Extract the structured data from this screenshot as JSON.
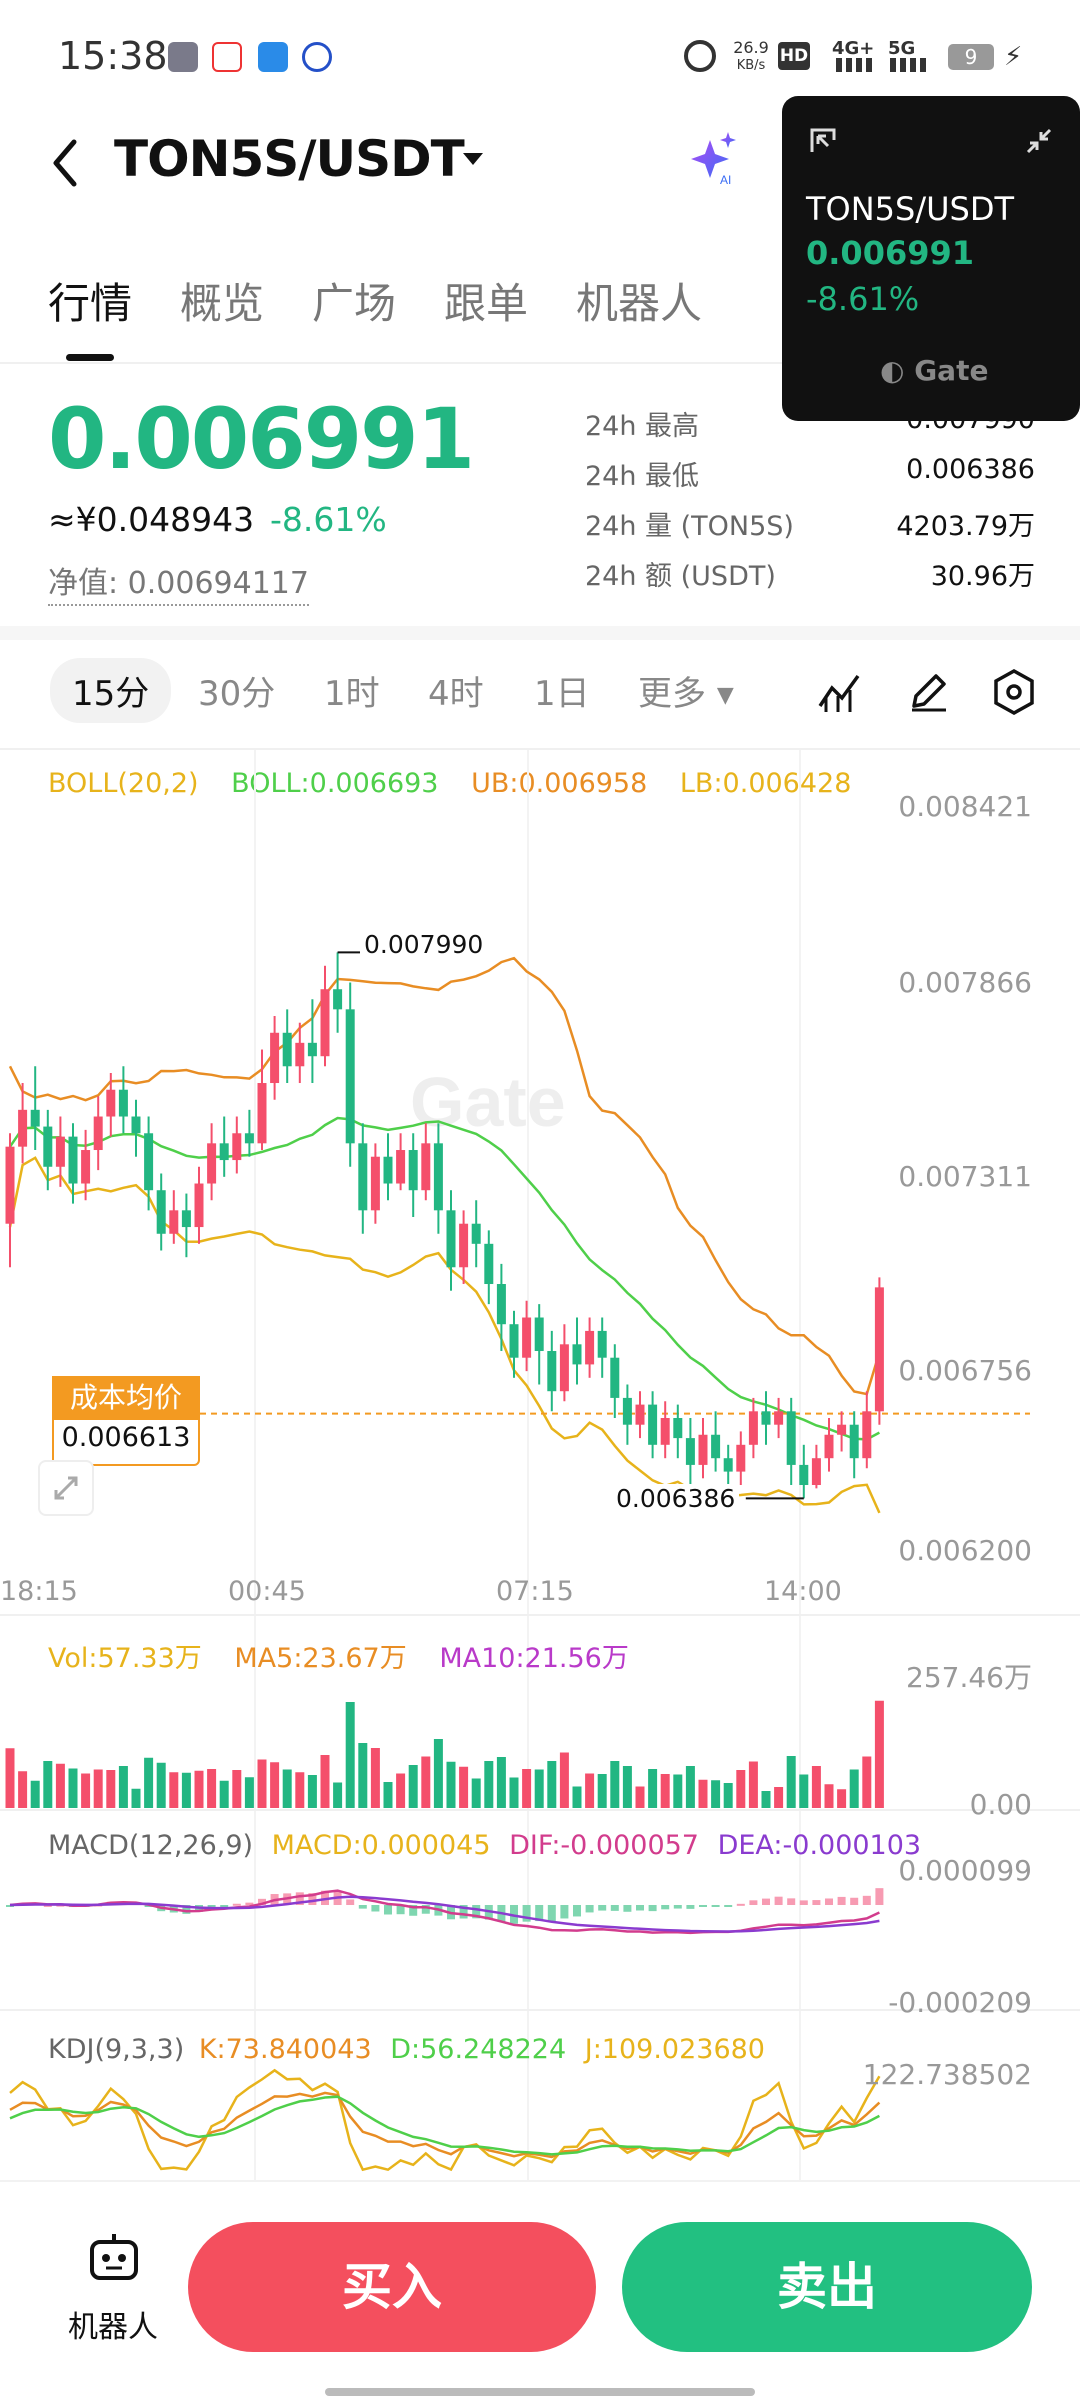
{
  "statusbar": {
    "time": "15:38",
    "net_speed_value": "26.9",
    "net_speed_unit": "KB/s",
    "hd": "HD",
    "sim1": "4G+",
    "sim2": "5G",
    "battery": "9",
    "app_icons": [
      "voice-recorder-icon",
      "weibo-icon",
      "app-icon",
      "blue-app-icon"
    ]
  },
  "header": {
    "pair": "TON5S/USDT",
    "ai_label": "AI"
  },
  "tabs": [
    "行情",
    "概览",
    "广场",
    "跟单",
    "机器人"
  ],
  "summary": {
    "last_price": "0.006991",
    "cny_price": "≈¥0.048943",
    "change_pct": "-8.61%",
    "nav": "净值: 0.00694117"
  },
  "stats": [
    {
      "label": "24h  最高",
      "value": "0.007990"
    },
    {
      "label": "24h  最低",
      "value": "0.006386"
    },
    {
      "label": "24h  量 (TON5S)",
      "value": "4203.79万"
    },
    {
      "label": "24h  额 (USDT)",
      "value": "30.96万"
    }
  ],
  "intervals": [
    "15分",
    "30分",
    "1时",
    "4时",
    "1日",
    "更多"
  ],
  "main_chart_legend": {
    "boll": "BOLL(20,2)",
    "boll_val": "BOLL:0.006693",
    "ub": "UB:0.006958",
    "lb": "LB:0.006428"
  },
  "cost_avg": {
    "label": "成本均价",
    "value": "0.006613"
  },
  "high_marker": "0.007990",
  "low_marker": "0.006386",
  "volume_legend": {
    "vol": "Vol:57.33万",
    "ma5": "MA5:23.67万",
    "ma10": "MA10:21.56万"
  },
  "macd_legend": {
    "title": "MACD(12,26,9)",
    "macd": "MACD:0.000045",
    "dif": "DIF:-0.000057",
    "dea": "DEA:-0.000103"
  },
  "kdj_legend": {
    "title": "KDJ(9,3,3)",
    "k": "K:73.840043",
    "d": "D:56.248224",
    "j": "J:109.023680"
  },
  "mini_card": {
    "pair": "TON5S/USDT",
    "price": "0.006991",
    "change": "-8.61%",
    "brand": "Gate"
  },
  "bottom": {
    "robot": "机器人",
    "buy": "买入",
    "sell": "卖出"
  },
  "colors": {
    "up": "#f44f6b",
    "down": "#22b682",
    "boll": "#4fcf4a",
    "ub": "#e88d24",
    "lb": "#e7b31b",
    "accent": "#f39a21"
  },
  "chart_data": {
    "type": "candlestick",
    "price_axis": [
      "0.008421",
      "0.007866",
      "0.007311",
      "0.006756",
      "0.006200"
    ],
    "volume_axis": [
      "257.46万",
      "0.00"
    ],
    "macd_axis": [
      "0.000099",
      "-0.000209"
    ],
    "kdj_axis": [
      "122.738502"
    ],
    "time_axis": [
      "18:15",
      "00:45",
      "07:15",
      "14:00"
    ],
    "ylim": [
      0.0062,
      0.008421
    ],
    "candles": [
      [
        0.00718,
        0.00741,
        0.00705,
        0.00745
      ],
      [
        0.00741,
        0.00752,
        0.00736,
        0.0076
      ],
      [
        0.00752,
        0.00747,
        0.0074,
        0.00765
      ],
      [
        0.00747,
        0.00735,
        0.00728,
        0.00752
      ],
      [
        0.00735,
        0.00744,
        0.00729,
        0.0075
      ],
      [
        0.00744,
        0.0073,
        0.00724,
        0.00748
      ],
      [
        0.0073,
        0.0074,
        0.00725,
        0.00746
      ],
      [
        0.0074,
        0.0075,
        0.00734,
        0.00756
      ],
      [
        0.0075,
        0.00758,
        0.00744,
        0.00763
      ],
      [
        0.00758,
        0.0075,
        0.00745,
        0.00765
      ],
      [
        0.0075,
        0.00745,
        0.00738,
        0.00755
      ],
      [
        0.00745,
        0.00728,
        0.00722,
        0.0075
      ],
      [
        0.00728,
        0.00715,
        0.0071,
        0.00733
      ],
      [
        0.00715,
        0.00722,
        0.00712,
        0.00728
      ],
      [
        0.00722,
        0.00717,
        0.00708,
        0.00727
      ],
      [
        0.00717,
        0.0073,
        0.00712,
        0.00735
      ],
      [
        0.0073,
        0.00742,
        0.00725,
        0.00748
      ],
      [
        0.00742,
        0.00737,
        0.00732,
        0.0075
      ],
      [
        0.00737,
        0.00745,
        0.00733,
        0.0075
      ],
      [
        0.00745,
        0.00742,
        0.00738,
        0.00752
      ],
      [
        0.00742,
        0.0076,
        0.0074,
        0.0077
      ],
      [
        0.0076,
        0.00775,
        0.00755,
        0.0078
      ],
      [
        0.00775,
        0.00765,
        0.0076,
        0.00782
      ],
      [
        0.00765,
        0.00772,
        0.0076,
        0.00778
      ],
      [
        0.00772,
        0.00768,
        0.0076,
        0.00785
      ],
      [
        0.00768,
        0.00788,
        0.00765,
        0.00795
      ],
      [
        0.00788,
        0.00782,
        0.00775,
        0.00799
      ],
      [
        0.00782,
        0.00742,
        0.00735,
        0.0079
      ],
      [
        0.00742,
        0.00722,
        0.00715,
        0.00748
      ],
      [
        0.00722,
        0.00738,
        0.00718,
        0.00742
      ],
      [
        0.00738,
        0.0073,
        0.00725,
        0.00745
      ],
      [
        0.0073,
        0.0074,
        0.00728,
        0.00745
      ],
      [
        0.0074,
        0.00728,
        0.0072,
        0.00745
      ],
      [
        0.00728,
        0.00742,
        0.00725,
        0.00748
      ],
      [
        0.00742,
        0.00722,
        0.00715,
        0.00748
      ],
      [
        0.00722,
        0.00705,
        0.00698,
        0.00728
      ],
      [
        0.00705,
        0.00718,
        0.007,
        0.00722
      ],
      [
        0.00718,
        0.00712,
        0.00705,
        0.00725
      ],
      [
        0.00712,
        0.007,
        0.00694,
        0.00716
      ],
      [
        0.007,
        0.00688,
        0.0068,
        0.00706
      ],
      [
        0.00688,
        0.00678,
        0.00672,
        0.00692
      ],
      [
        0.00678,
        0.0069,
        0.00674,
        0.00695
      ],
      [
        0.0069,
        0.0068,
        0.0067,
        0.00694
      ],
      [
        0.0068,
        0.00668,
        0.00662,
        0.00686
      ],
      [
        0.00668,
        0.00682,
        0.00665,
        0.00688
      ],
      [
        0.00682,
        0.00676,
        0.0067,
        0.0069
      ],
      [
        0.00676,
        0.00686,
        0.00672,
        0.0069
      ],
      [
        0.00686,
        0.00678,
        0.00672,
        0.0069
      ],
      [
        0.00678,
        0.00666,
        0.0066,
        0.00682
      ],
      [
        0.00666,
        0.00658,
        0.00652,
        0.0067
      ],
      [
        0.00658,
        0.00664,
        0.00654,
        0.00668
      ],
      [
        0.00664,
        0.00652,
        0.00648,
        0.00668
      ],
      [
        0.00652,
        0.0066,
        0.00648,
        0.00665
      ],
      [
        0.0066,
        0.00654,
        0.00648,
        0.00664
      ],
      [
        0.00654,
        0.00646,
        0.0064,
        0.0066
      ],
      [
        0.00646,
        0.00655,
        0.00642,
        0.0066
      ],
      [
        0.00655,
        0.00648,
        0.00644,
        0.00662
      ],
      [
        0.00648,
        0.00644,
        0.0064,
        0.00652
      ],
      [
        0.00644,
        0.00652,
        0.0064,
        0.00656
      ],
      [
        0.00652,
        0.00662,
        0.00648,
        0.00666
      ],
      [
        0.00662,
        0.00658,
        0.00652,
        0.00668
      ],
      [
        0.00658,
        0.00662,
        0.00654,
        0.00666
      ],
      [
        0.00662,
        0.00646,
        0.0064,
        0.00666
      ],
      [
        0.00646,
        0.0064,
        0.00636,
        0.00652
      ],
      [
        0.0064,
        0.00648,
        0.00639,
        0.00652
      ],
      [
        0.00648,
        0.00655,
        0.00644,
        0.0066
      ],
      [
        0.00655,
        0.00658,
        0.0065,
        0.00662
      ],
      [
        0.00658,
        0.00648,
        0.00642,
        0.00662
      ],
      [
        0.00648,
        0.00662,
        0.00645,
        0.00668
      ],
      [
        0.00662,
        0.00699,
        0.00658,
        0.00702
      ]
    ]
  }
}
